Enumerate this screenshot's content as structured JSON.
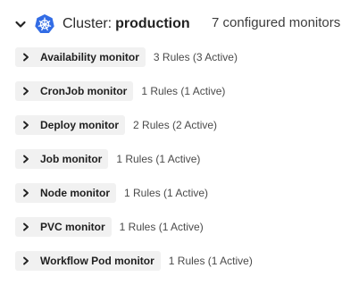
{
  "cluster": {
    "label": "Cluster:",
    "name": "production",
    "configured_count": "7 configured monitors",
    "icon": "kubernetes-icon",
    "brand_color": "#326ce5"
  },
  "monitors": [
    {
      "name": "Availability monitor",
      "rules": "3 Rules (3 Active)"
    },
    {
      "name": "CronJob monitor",
      "rules": "1 Rules (1 Active)"
    },
    {
      "name": "Deploy monitor",
      "rules": "2 Rules (2 Active)"
    },
    {
      "name": "Job monitor",
      "rules": "1 Rules (1 Active)"
    },
    {
      "name": "Node monitor",
      "rules": "1 Rules (1 Active)"
    },
    {
      "name": "PVC monitor",
      "rules": "1 Rules (1 Active)"
    },
    {
      "name": "Workflow Pod monitor",
      "rules": "1 Rules (1 Active)"
    }
  ]
}
